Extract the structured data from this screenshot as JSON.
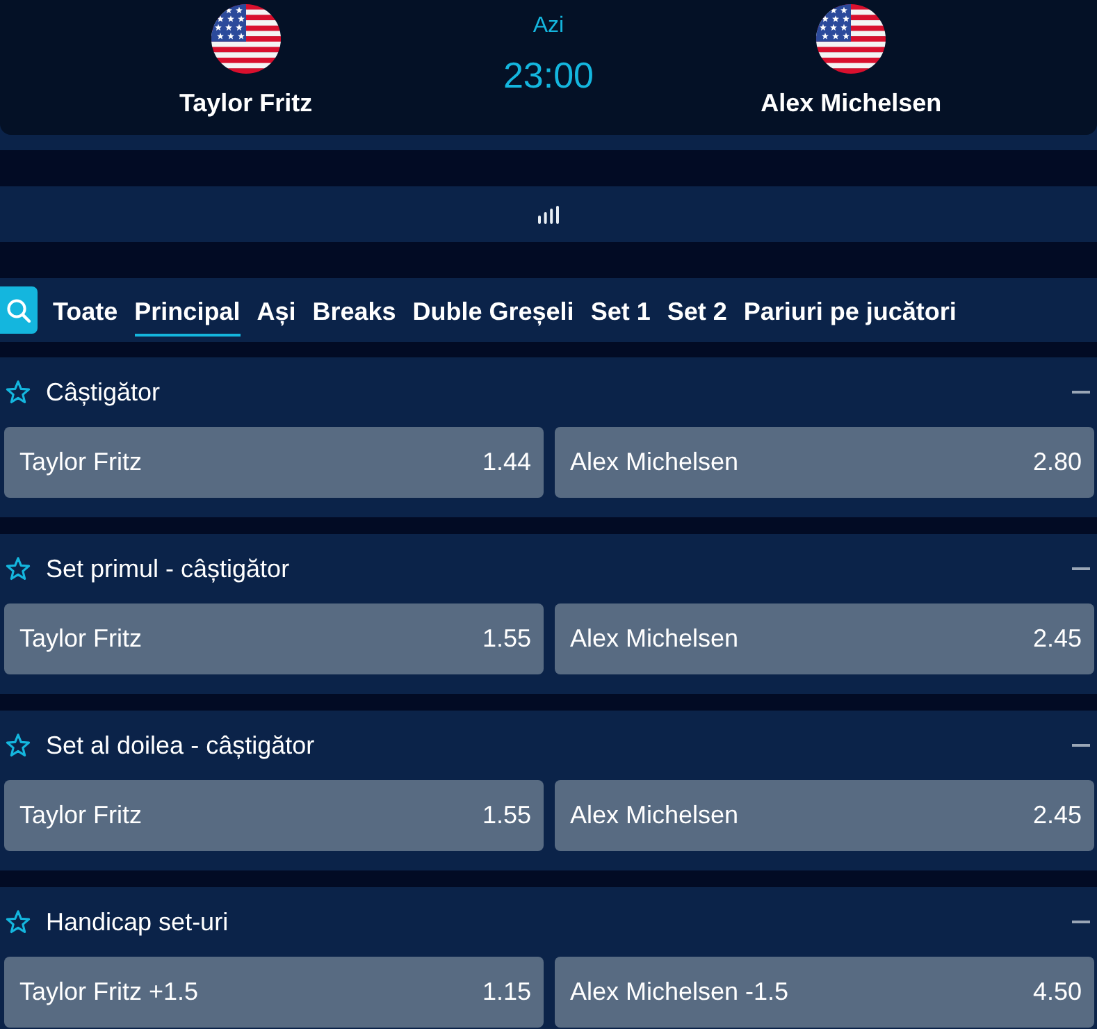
{
  "match": {
    "home": {
      "name": "Taylor Fritz"
    },
    "day": "Azi",
    "time": "23:00",
    "away": {
      "name": "Alex Michelsen"
    }
  },
  "tabs": [
    {
      "label": "Toate",
      "selected": false
    },
    {
      "label": "Principal",
      "selected": true
    },
    {
      "label": "Ași",
      "selected": false
    },
    {
      "label": "Breaks",
      "selected": false
    },
    {
      "label": "Duble Greșeli",
      "selected": false
    },
    {
      "label": "Set 1",
      "selected": false
    },
    {
      "label": "Set 2",
      "selected": false
    },
    {
      "label": "Pariuri pe jucători",
      "selected": false
    }
  ],
  "markets": [
    {
      "title": "Câștigător",
      "favorite": false,
      "expanded": true,
      "selections": [
        {
          "name": "Taylor Fritz",
          "odds": "1.44"
        },
        {
          "name": "Alex Michelsen",
          "odds": "2.80"
        }
      ]
    },
    {
      "title": "Set primul - câștigător",
      "favorite": false,
      "expanded": true,
      "selections": [
        {
          "name": "Taylor Fritz",
          "odds": "1.55"
        },
        {
          "name": "Alex Michelsen",
          "odds": "2.45"
        }
      ]
    },
    {
      "title": "Set al doilea - câștigător",
      "favorite": false,
      "expanded": true,
      "selections": [
        {
          "name": "Taylor Fritz",
          "odds": "1.55"
        },
        {
          "name": "Alex Michelsen",
          "odds": "2.45"
        }
      ]
    },
    {
      "title": "Handicap set-uri",
      "favorite": false,
      "expanded": true,
      "selections": [
        {
          "name": "Taylor Fritz +1.5",
          "odds": "1.15"
        },
        {
          "name": "Alex Michelsen -1.5",
          "odds": "4.50"
        }
      ]
    }
  ]
}
